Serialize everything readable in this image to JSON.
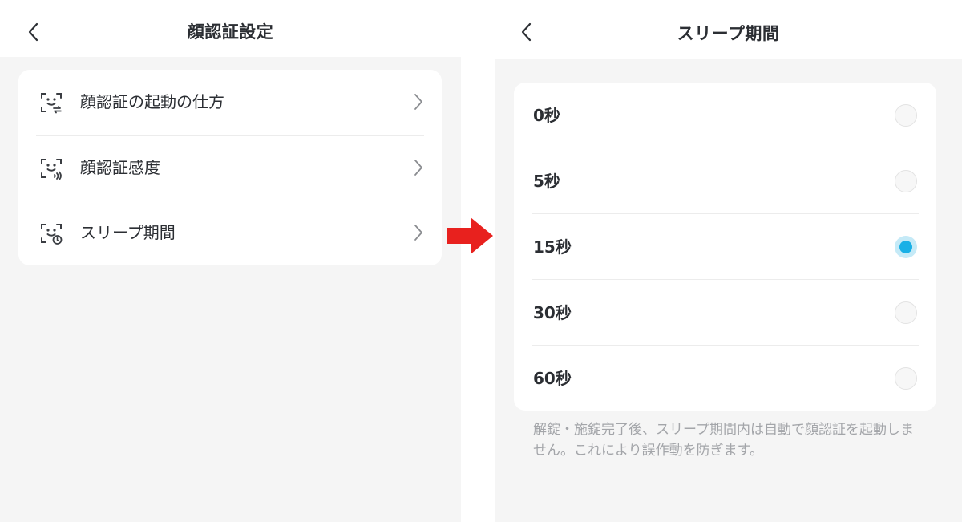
{
  "left_screen": {
    "title": "顔認証設定",
    "back_icon": "chevron-left-icon",
    "items": [
      {
        "label": "顔認証の起動の仕方",
        "icon": "face-swap-icon"
      },
      {
        "label": "顔認証感度",
        "icon": "face-signal-icon"
      },
      {
        "label": "スリープ期間",
        "icon": "face-clock-icon"
      }
    ]
  },
  "right_screen": {
    "title": "スリープ期間",
    "back_icon": "chevron-left-icon",
    "options": [
      {
        "label": "0秒",
        "selected": false
      },
      {
        "label": "5秒",
        "selected": false
      },
      {
        "label": "15秒",
        "selected": true
      },
      {
        "label": "30秒",
        "selected": false
      },
      {
        "label": "60秒",
        "selected": false
      }
    ],
    "footnote": "解錠・施錠完了後、スリープ期間内は自動で顔認証を起動しません。これにより誤作動を防ぎます。"
  },
  "colors": {
    "accent": "#1ab0e6",
    "accent_light": "#c5eaf7",
    "arrow": "#e8211e",
    "background": "#f5f5f5",
    "text": "#2b2e33",
    "muted_text": "#a3a5a9"
  }
}
